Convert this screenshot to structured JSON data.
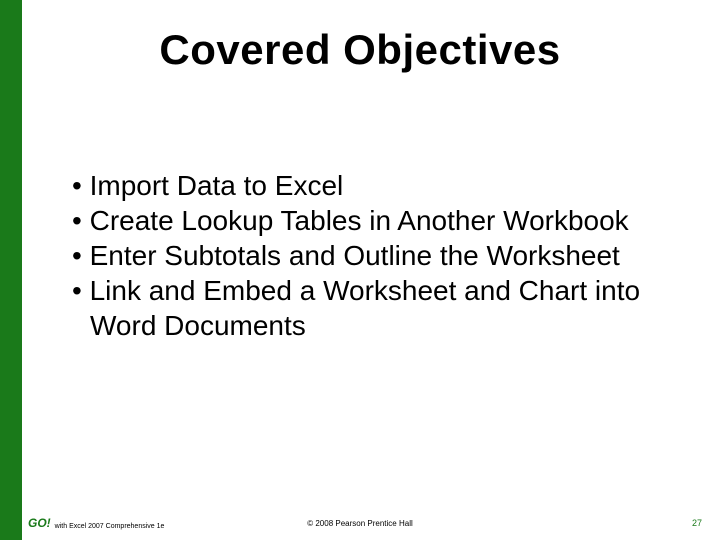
{
  "title": "Covered Objectives",
  "bullets": {
    "b1": "Import Data to Excel",
    "b2": "Create Lookup Tables in Another Workbook",
    "b3": "Enter Subtotals and Outline the Worksheet",
    "b4": "Link and Embed a Worksheet and Chart into Word Documents"
  },
  "footer": {
    "logo_text": "GO!",
    "logo_sub": "with Excel 2007 Comprehensive 1e",
    "copyright": "© 2008 Pearson Prentice Hall",
    "page_number": "27"
  },
  "colors": {
    "accent": "#1a7a1a"
  }
}
